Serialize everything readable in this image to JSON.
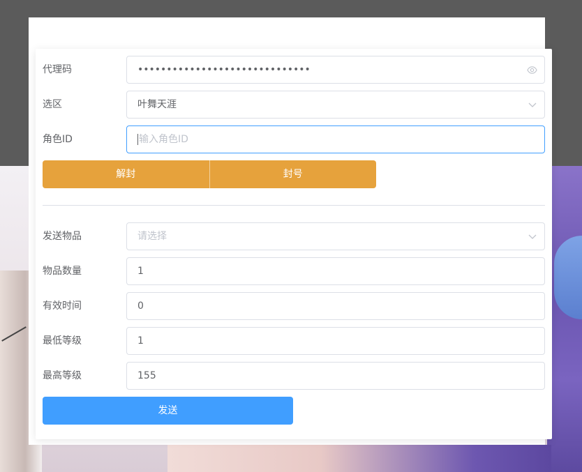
{
  "agent_code": {
    "label": "代理码",
    "value": "••••••••••••••••••••••••••••••"
  },
  "zone": {
    "label": "选区",
    "value": "叶舞天涯"
  },
  "role_id": {
    "label": "角色ID",
    "placeholder": "输入角色ID"
  },
  "actions": {
    "unban_label": "解封",
    "ban_label": "封号"
  },
  "send_item": {
    "label": "发送物品",
    "placeholder": "请选择"
  },
  "item_quantity": {
    "label": "物品数量",
    "value": "1"
  },
  "valid_time": {
    "label": "有效时间",
    "value": "0"
  },
  "min_level": {
    "label": "最低等级",
    "value": "1"
  },
  "max_level": {
    "label": "最高等级",
    "value": "155"
  },
  "send_button": {
    "label": "发送"
  },
  "colors": {
    "warning": "#e6a23c",
    "primary": "#409eff",
    "border": "#dcdfe6",
    "placeholder": "#c0c4cc",
    "text": "#606266"
  },
  "icons": {
    "password_toggle": "eye-icon",
    "select_arrow": "chevron-down-icon"
  }
}
